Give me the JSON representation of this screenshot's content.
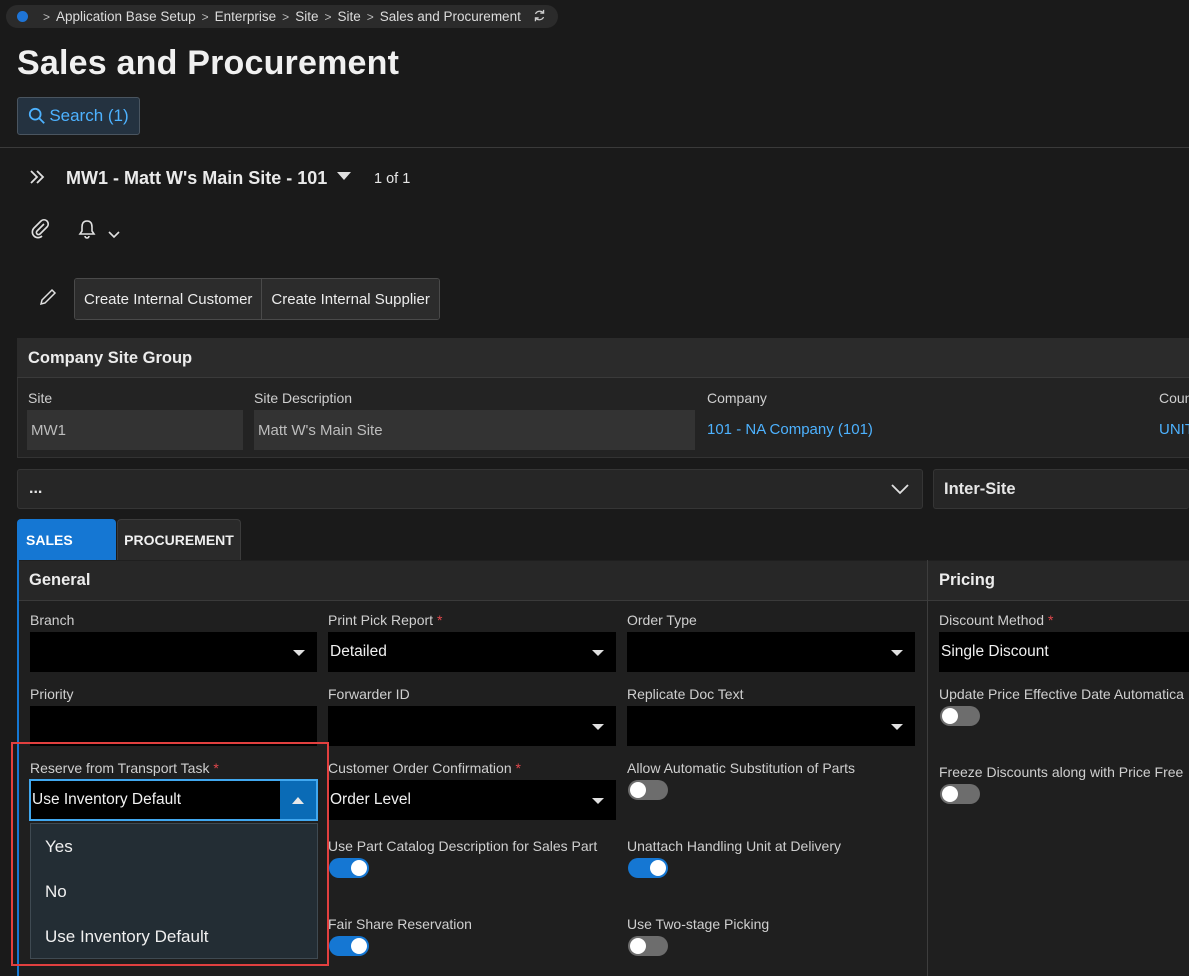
{
  "breadcrumb": [
    "Application Base Setup",
    "Enterprise",
    "Site",
    "Site",
    "Sales and Procurement"
  ],
  "page_title": "Sales and Procurement",
  "search_label": "Search (1)",
  "record": {
    "title": "MW1 - Matt W's Main Site - 101",
    "pager": "1 of 1"
  },
  "commands": {
    "create_customer": "Create Internal Customer",
    "create_supplier": "Create Internal Supplier"
  },
  "group": {
    "title": "Company Site Group",
    "site_label": "Site",
    "site_value": "MW1",
    "desc_label": "Site Description",
    "desc_value": "Matt W's Main Site",
    "company_label": "Company",
    "company_value": "101 - NA Company (101)",
    "country_label": "Coun",
    "country_value": "UNIT"
  },
  "collapsibles": {
    "more": "...",
    "intersite": "Inter-Site"
  },
  "tabs": [
    "SALES",
    "PROCUREMENT"
  ],
  "general": {
    "title": "General",
    "branch_label": "Branch",
    "branch_value": "",
    "print_pick_label": "Print Pick Report",
    "print_pick_value": "Detailed",
    "order_type_label": "Order Type",
    "order_type_value": "",
    "priority_label": "Priority",
    "priority_value": "",
    "forwarder_label": "Forwarder ID",
    "forwarder_value": "",
    "replicate_label": "Replicate Doc Text",
    "replicate_value": "",
    "reserve_label": "Reserve from Transport Task",
    "reserve_value": "Use Inventory Default",
    "confirm_label": "Customer Order Confirmation",
    "confirm_value": "Order Level",
    "auto_sub_label": "Allow Automatic Substitution of Parts",
    "auto_sub_on": false,
    "part_catalog_label": "Use Part Catalog Description for Sales Part",
    "part_catalog_on": true,
    "unattach_label": "Unattach Handling Unit at Delivery",
    "unattach_on": true,
    "fair_share_label": "Fair Share Reservation",
    "fair_share_on": true,
    "two_stage_label": "Use Two-stage Picking",
    "two_stage_on": false,
    "reserve_options": [
      "Yes",
      "No",
      "Use Inventory Default"
    ]
  },
  "pricing": {
    "title": "Pricing",
    "discount_label": "Discount Method",
    "discount_value": "Single Discount",
    "update_price_label": "Update Price Effective Date Automatica",
    "update_price_on": false,
    "freeze_label": "Freeze Discounts along with Price Free",
    "freeze_on": false
  },
  "colors": {
    "accent": "#1577d3",
    "link": "#4db2ff",
    "required": "#e0474c",
    "highlight": "#e2403f"
  }
}
